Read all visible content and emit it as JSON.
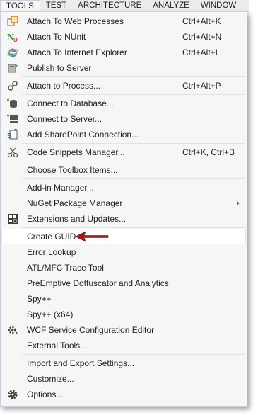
{
  "menubar": {
    "items": [
      {
        "label": "TOOLS",
        "active": true
      },
      {
        "label": "TEST"
      },
      {
        "label": "ARCHITECTURE"
      },
      {
        "label": "ANALYZE"
      },
      {
        "label": "WINDOW"
      }
    ]
  },
  "menu": {
    "items": [
      {
        "label": "Attach To Web Processes",
        "shortcut": "Ctrl+Alt+K",
        "icon": "attach-web-processes-icon"
      },
      {
        "label": "Attach To NUnit",
        "shortcut": "Ctrl+Alt+N",
        "icon": "nunit-icon"
      },
      {
        "label": "Attach To Internet Explorer",
        "shortcut": "Ctrl+Alt+I",
        "icon": "internet-explorer-icon"
      },
      {
        "label": "Publish to Server",
        "icon": "publish-server-icon"
      },
      {
        "label": "Attach to Process...",
        "shortcut": "Ctrl+Alt+P",
        "icon": "attach-process-icon"
      },
      {
        "label": "Connect to Database...",
        "icon": "connect-database-icon"
      },
      {
        "label": "Connect to Server...",
        "icon": "connect-server-icon"
      },
      {
        "label": "Add SharePoint Connection...",
        "icon": "sharepoint-icon"
      },
      {
        "label": "Code Snippets Manager...",
        "shortcut": "Ctrl+K, Ctrl+B",
        "icon": "code-snippets-icon"
      },
      {
        "label": "Choose Toolbox Items..."
      },
      {
        "label": "Add-in Manager..."
      },
      {
        "label": "NuGet Package Manager",
        "submenu": true
      },
      {
        "label": "Extensions and Updates...",
        "icon": "extensions-icon"
      },
      {
        "label": "Create GUID",
        "highlighted": true
      },
      {
        "label": "Error Lookup"
      },
      {
        "label": "ATL/MFC Trace Tool"
      },
      {
        "label": "PreEmptive Dotfuscator and Analytics"
      },
      {
        "label": "Spy++"
      },
      {
        "label": "Spy++ (x64)"
      },
      {
        "label": "WCF Service Configuration Editor",
        "icon": "wcf-config-icon"
      },
      {
        "label": "External Tools..."
      },
      {
        "label": "Import and Export Settings..."
      },
      {
        "label": "Customize..."
      },
      {
        "label": "Options...",
        "icon": "gear-icon"
      }
    ]
  },
  "callout": {
    "color": "#9b1b1b",
    "points_to": "Create GUID"
  }
}
